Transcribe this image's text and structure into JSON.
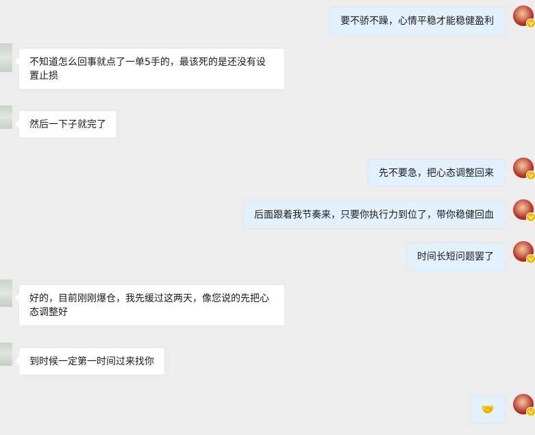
{
  "messages": [
    {
      "side": "right",
      "text": "要不骄不躁，心情平稳才能稳健盈利"
    },
    {
      "side": "left",
      "text": "不知道怎么回事就点了一单5手的，最该死的是还没有设置止损"
    },
    {
      "side": "left",
      "text": "然后一下子就完了"
    },
    {
      "side": "right",
      "text": "先不要急，把心态调整回来"
    },
    {
      "side": "right",
      "text": "后面跟着我节奏来，只要你执行力到位了，带你稳健回血"
    },
    {
      "side": "right",
      "text": "时间长短问题罢了"
    },
    {
      "side": "left",
      "text": "好的，目前刚刚爆仓，我先缓过这两天，像您说的先把心态调整好"
    },
    {
      "side": "left",
      "text": "到时候一定第一时间过来找你"
    },
    {
      "side": "right",
      "text": "🤝",
      "kind": "emoji",
      "icon": "handshake-icon"
    }
  ],
  "colors": {
    "background": "#ededed",
    "left_bubble": "#ffffff",
    "right_bubble": "#e3f1fd",
    "badge": "#f5b800"
  }
}
